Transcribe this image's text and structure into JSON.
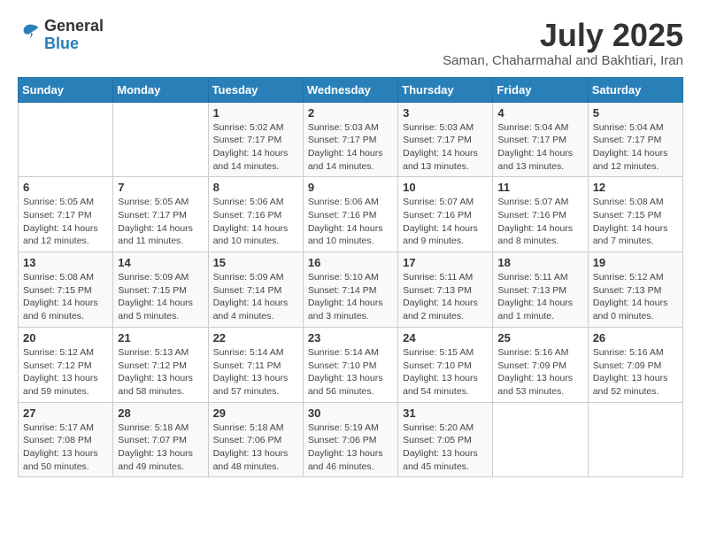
{
  "logo": {
    "text_general": "General",
    "text_blue": "Blue"
  },
  "header": {
    "month_title": "July 2025",
    "subtitle": "Saman, Chaharmahal and Bakhtiari, Iran"
  },
  "weekdays": [
    "Sunday",
    "Monday",
    "Tuesday",
    "Wednesday",
    "Thursday",
    "Friday",
    "Saturday"
  ],
  "weeks": [
    [
      {
        "day": "",
        "info": ""
      },
      {
        "day": "",
        "info": ""
      },
      {
        "day": "1",
        "info": "Sunrise: 5:02 AM\nSunset: 7:17 PM\nDaylight: 14 hours and 14 minutes."
      },
      {
        "day": "2",
        "info": "Sunrise: 5:03 AM\nSunset: 7:17 PM\nDaylight: 14 hours and 14 minutes."
      },
      {
        "day": "3",
        "info": "Sunrise: 5:03 AM\nSunset: 7:17 PM\nDaylight: 14 hours and 13 minutes."
      },
      {
        "day": "4",
        "info": "Sunrise: 5:04 AM\nSunset: 7:17 PM\nDaylight: 14 hours and 13 minutes."
      },
      {
        "day": "5",
        "info": "Sunrise: 5:04 AM\nSunset: 7:17 PM\nDaylight: 14 hours and 12 minutes."
      }
    ],
    [
      {
        "day": "6",
        "info": "Sunrise: 5:05 AM\nSunset: 7:17 PM\nDaylight: 14 hours and 12 minutes."
      },
      {
        "day": "7",
        "info": "Sunrise: 5:05 AM\nSunset: 7:17 PM\nDaylight: 14 hours and 11 minutes."
      },
      {
        "day": "8",
        "info": "Sunrise: 5:06 AM\nSunset: 7:16 PM\nDaylight: 14 hours and 10 minutes."
      },
      {
        "day": "9",
        "info": "Sunrise: 5:06 AM\nSunset: 7:16 PM\nDaylight: 14 hours and 10 minutes."
      },
      {
        "day": "10",
        "info": "Sunrise: 5:07 AM\nSunset: 7:16 PM\nDaylight: 14 hours and 9 minutes."
      },
      {
        "day": "11",
        "info": "Sunrise: 5:07 AM\nSunset: 7:16 PM\nDaylight: 14 hours and 8 minutes."
      },
      {
        "day": "12",
        "info": "Sunrise: 5:08 AM\nSunset: 7:15 PM\nDaylight: 14 hours and 7 minutes."
      }
    ],
    [
      {
        "day": "13",
        "info": "Sunrise: 5:08 AM\nSunset: 7:15 PM\nDaylight: 14 hours and 6 minutes."
      },
      {
        "day": "14",
        "info": "Sunrise: 5:09 AM\nSunset: 7:15 PM\nDaylight: 14 hours and 5 minutes."
      },
      {
        "day": "15",
        "info": "Sunrise: 5:09 AM\nSunset: 7:14 PM\nDaylight: 14 hours and 4 minutes."
      },
      {
        "day": "16",
        "info": "Sunrise: 5:10 AM\nSunset: 7:14 PM\nDaylight: 14 hours and 3 minutes."
      },
      {
        "day": "17",
        "info": "Sunrise: 5:11 AM\nSunset: 7:13 PM\nDaylight: 14 hours and 2 minutes."
      },
      {
        "day": "18",
        "info": "Sunrise: 5:11 AM\nSunset: 7:13 PM\nDaylight: 14 hours and 1 minute."
      },
      {
        "day": "19",
        "info": "Sunrise: 5:12 AM\nSunset: 7:13 PM\nDaylight: 14 hours and 0 minutes."
      }
    ],
    [
      {
        "day": "20",
        "info": "Sunrise: 5:12 AM\nSunset: 7:12 PM\nDaylight: 13 hours and 59 minutes."
      },
      {
        "day": "21",
        "info": "Sunrise: 5:13 AM\nSunset: 7:12 PM\nDaylight: 13 hours and 58 minutes."
      },
      {
        "day": "22",
        "info": "Sunrise: 5:14 AM\nSunset: 7:11 PM\nDaylight: 13 hours and 57 minutes."
      },
      {
        "day": "23",
        "info": "Sunrise: 5:14 AM\nSunset: 7:10 PM\nDaylight: 13 hours and 56 minutes."
      },
      {
        "day": "24",
        "info": "Sunrise: 5:15 AM\nSunset: 7:10 PM\nDaylight: 13 hours and 54 minutes."
      },
      {
        "day": "25",
        "info": "Sunrise: 5:16 AM\nSunset: 7:09 PM\nDaylight: 13 hours and 53 minutes."
      },
      {
        "day": "26",
        "info": "Sunrise: 5:16 AM\nSunset: 7:09 PM\nDaylight: 13 hours and 52 minutes."
      }
    ],
    [
      {
        "day": "27",
        "info": "Sunrise: 5:17 AM\nSunset: 7:08 PM\nDaylight: 13 hours and 50 minutes."
      },
      {
        "day": "28",
        "info": "Sunrise: 5:18 AM\nSunset: 7:07 PM\nDaylight: 13 hours and 49 minutes."
      },
      {
        "day": "29",
        "info": "Sunrise: 5:18 AM\nSunset: 7:06 PM\nDaylight: 13 hours and 48 minutes."
      },
      {
        "day": "30",
        "info": "Sunrise: 5:19 AM\nSunset: 7:06 PM\nDaylight: 13 hours and 46 minutes."
      },
      {
        "day": "31",
        "info": "Sunrise: 5:20 AM\nSunset: 7:05 PM\nDaylight: 13 hours and 45 minutes."
      },
      {
        "day": "",
        "info": ""
      },
      {
        "day": "",
        "info": ""
      }
    ]
  ]
}
